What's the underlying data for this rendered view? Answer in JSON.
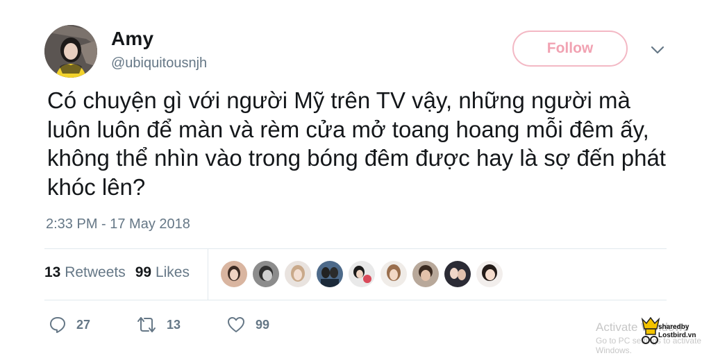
{
  "user": {
    "name": "Amy",
    "handle": "@ubiquitousnjh"
  },
  "follow_label": "Follow",
  "tweet": {
    "text": "Có chuyện gì với người Mỹ trên TV vậy, những người mà luôn luôn để màn và rèm cửa mở toang hoang mỗi đêm ấy, không thể nhìn vào trong bóng đêm được hay là sợ đến phát khóc lên?",
    "timestamp": "2:33 PM - 17 May 2018"
  },
  "stats": {
    "retweets_count": "13",
    "retweets_label": "Retweets",
    "likes_count": "99",
    "likes_label": "Likes"
  },
  "actions": {
    "reply_count": "27",
    "retweet_count": "13",
    "like_count": "99"
  },
  "watermark": {
    "activate": "Activate Windows",
    "goto": "Go to PC settings to activate Windows.",
    "logo_line1": "sharedby",
    "logo_line2": "Lostbird.vn"
  },
  "colors": {
    "follow_border": "#f3b8c4",
    "follow_text": "#f1a2b2",
    "secondary_text": "#657786",
    "divider": "#e1e8ed"
  },
  "icons": {
    "chevron": "chevron-down-icon",
    "reply": "reply-icon",
    "retweet": "retweet-icon",
    "like": "heart-icon"
  }
}
